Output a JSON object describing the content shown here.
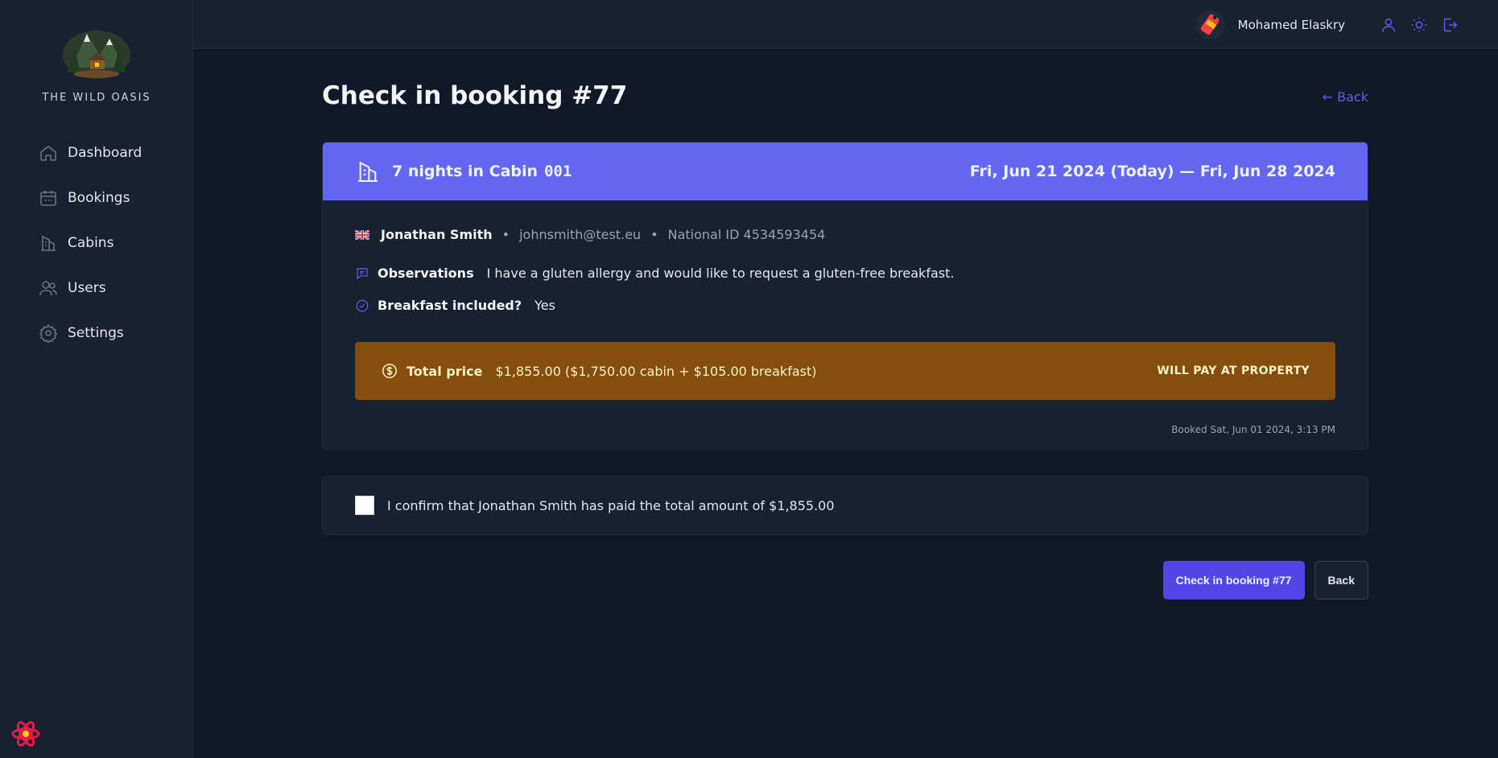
{
  "brand": {
    "name": "THE WILD OASIS"
  },
  "sidebar": {
    "items": [
      {
        "label": "Dashboard",
        "icon": "home-icon"
      },
      {
        "label": "Bookings",
        "icon": "calendar-icon"
      },
      {
        "label": "Cabins",
        "icon": "building-icon"
      },
      {
        "label": "Users",
        "icon": "users-icon"
      },
      {
        "label": "Settings",
        "icon": "gear-icon"
      }
    ]
  },
  "header": {
    "user_name": "Mohamed Elaskry",
    "icons": [
      "user-icon",
      "sun-icon",
      "logout-icon"
    ]
  },
  "page": {
    "title": "Check in booking #77",
    "back_link": "← Back"
  },
  "booking": {
    "nights_label": "7 nights in Cabin",
    "cabin_name": "001",
    "dates": "Fri, Jun 21 2024 (Today) — Fri, Jun 28 2024",
    "guest_name": "Jonathan Smith",
    "separator": "•",
    "email": "johnsmith@test.eu",
    "national_id": "National ID 4534593454",
    "observations_label": "Observations",
    "observations_text": "I have a gluten allergy and would like to request a gluten-free breakfast.",
    "breakfast_label": "Breakfast included?",
    "breakfast_value": "Yes",
    "price_label": "Total price",
    "price_value": "$1,855.00 ($1,750.00 cabin + $105.00 breakfast)",
    "payment_status": "WILL PAY AT PROPERTY",
    "booked_at": "Booked Sat, Jun 01 2024, 3:13 PM"
  },
  "confirm": {
    "text": "I confirm that Jonathan Smith has paid the total amount of $1,855.00",
    "checked": false
  },
  "actions": {
    "checkin_label": "Check in booking #77",
    "back_label": "Back"
  },
  "colors": {
    "accent": "#6366f1",
    "button": "#4f46e5",
    "price_bg": "#854d0e",
    "sidebar_bg": "#18212f",
    "page_bg": "#111827"
  }
}
